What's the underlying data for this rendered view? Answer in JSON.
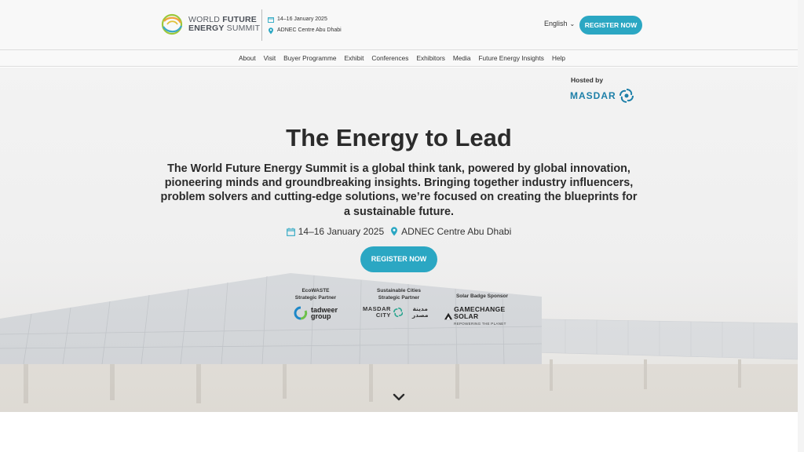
{
  "header": {
    "logo_line1": "WORLD ",
    "logo_line1_bold": "FUTURE",
    "logo_line2_bold": "ENERGY",
    "logo_line2": " SUMMIT",
    "date": "14–16 January 2025",
    "venue": "ADNEC Centre Abu Dhabi",
    "language": "English",
    "register_label": "REGISTER NOW"
  },
  "nav": {
    "items": [
      "About",
      "Visit",
      "Buyer Programme",
      "Exhibit",
      "Conferences",
      "Exhibitors",
      "Media",
      "Future Energy Insights",
      "Help"
    ]
  },
  "hero": {
    "hosted_by": "Hosted by",
    "host_name": "MASDAR",
    "title": "The Energy to Lead",
    "description": "The World Future Energy Summit is a global think tank, powered by global innovation, pioneering minds and groundbreaking insights. Bringing together industry influencers, problem solvers and cutting-edge solutions, we’re focused on creating the blueprints for a sustainable future.",
    "date": "14–16 January 2025",
    "venue": "ADNEC Centre Abu Dhabi",
    "register_label": "REGISTER NOW"
  },
  "partners": [
    {
      "label_line1": "EcoWASTE",
      "label_line2": "Strategic Partner",
      "logo_text_line1": "tadweer",
      "logo_text_line2": "group"
    },
    {
      "label_line1": "Sustainable Cities",
      "label_line2": "Strategic Partner",
      "logo_text_line1": "MASDAR",
      "logo_text_line2": "CITY",
      "logo_text_arabic": "مدينة مصدر"
    },
    {
      "label_line1": "Solar Badge Sponsor",
      "logo_text_line1": "GAMECHANGE SOLAR",
      "logo_text_line2": "REPOWERING THE PLANET"
    }
  ],
  "colors": {
    "accent": "#2ba7c3",
    "masdar_blue": "#1d7fa8",
    "text_dark": "#2b2b2b"
  },
  "icons": {
    "calendar": "calendar-icon",
    "location": "location-pin-icon",
    "scroll": "chevron-down-icon"
  }
}
